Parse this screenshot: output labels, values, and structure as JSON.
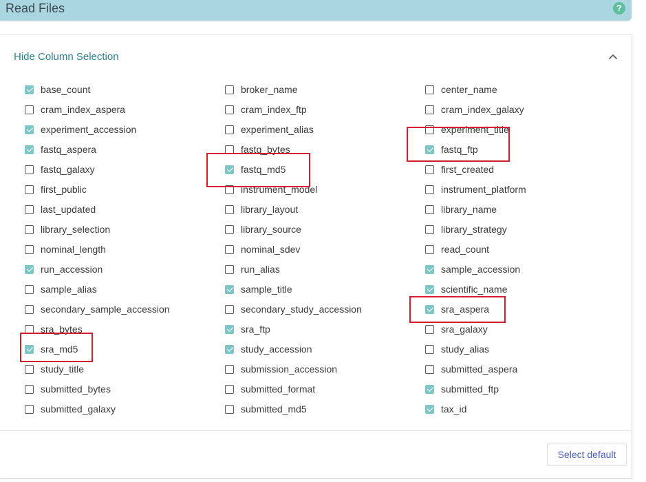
{
  "header": {
    "title": "Read Files",
    "help_label": "?"
  },
  "panel": {
    "toggle_label": "Hide Column Selection"
  },
  "columns": [
    [
      {
        "label": "base_count",
        "checked": true
      },
      {
        "label": "cram_index_aspera",
        "checked": false
      },
      {
        "label": "experiment_accession",
        "checked": true
      },
      {
        "label": "fastq_aspera",
        "checked": true
      },
      {
        "label": "fastq_galaxy",
        "checked": false
      },
      {
        "label": "first_public",
        "checked": false
      },
      {
        "label": "last_updated",
        "checked": false
      },
      {
        "label": "library_selection",
        "checked": false
      },
      {
        "label": "nominal_length",
        "checked": false
      },
      {
        "label": "run_accession",
        "checked": true
      },
      {
        "label": "sample_alias",
        "checked": false
      },
      {
        "label": "secondary_sample_accession",
        "checked": false
      },
      {
        "label": "sra_bytes",
        "checked": false
      },
      {
        "label": "sra_md5",
        "checked": true
      },
      {
        "label": "study_title",
        "checked": false
      },
      {
        "label": "submitted_bytes",
        "checked": false
      },
      {
        "label": "submitted_galaxy",
        "checked": false
      }
    ],
    [
      {
        "label": "broker_name",
        "checked": false
      },
      {
        "label": "cram_index_ftp",
        "checked": false
      },
      {
        "label": "experiment_alias",
        "checked": false
      },
      {
        "label": "fastq_bytes",
        "checked": false
      },
      {
        "label": "fastq_md5",
        "checked": true
      },
      {
        "label": "instrument_model",
        "checked": false
      },
      {
        "label": "library_layout",
        "checked": false
      },
      {
        "label": "library_source",
        "checked": false
      },
      {
        "label": "nominal_sdev",
        "checked": false
      },
      {
        "label": "run_alias",
        "checked": false
      },
      {
        "label": "sample_title",
        "checked": true
      },
      {
        "label": "secondary_study_accession",
        "checked": false
      },
      {
        "label": "sra_ftp",
        "checked": true
      },
      {
        "label": "study_accession",
        "checked": true
      },
      {
        "label": "submission_accession",
        "checked": false
      },
      {
        "label": "submitted_format",
        "checked": false
      },
      {
        "label": "submitted_md5",
        "checked": false
      }
    ],
    [
      {
        "label": "center_name",
        "checked": false
      },
      {
        "label": "cram_index_galaxy",
        "checked": false
      },
      {
        "label": "experiment_title",
        "checked": false
      },
      {
        "label": "fastq_ftp",
        "checked": true
      },
      {
        "label": "first_created",
        "checked": false
      },
      {
        "label": "instrument_platform",
        "checked": false
      },
      {
        "label": "library_name",
        "checked": false
      },
      {
        "label": "library_strategy",
        "checked": false
      },
      {
        "label": "read_count",
        "checked": false
      },
      {
        "label": "sample_accession",
        "checked": true
      },
      {
        "label": "scientific_name",
        "checked": true
      },
      {
        "label": "sra_aspera",
        "checked": true
      },
      {
        "label": "sra_galaxy",
        "checked": false
      },
      {
        "label": "study_alias",
        "checked": false
      },
      {
        "label": "submitted_aspera",
        "checked": false
      },
      {
        "label": "submitted_ftp",
        "checked": true
      },
      {
        "label": "tax_id",
        "checked": true
      }
    ]
  ],
  "footer": {
    "select_default_label": "Select default"
  },
  "colors": {
    "header_bg": "#a9d6e0",
    "checkbox_checked": "#7ec7c6",
    "toggle_link": "#2f7f8c",
    "button_text": "#4a5fc1",
    "highlight": "#d51c2c"
  }
}
